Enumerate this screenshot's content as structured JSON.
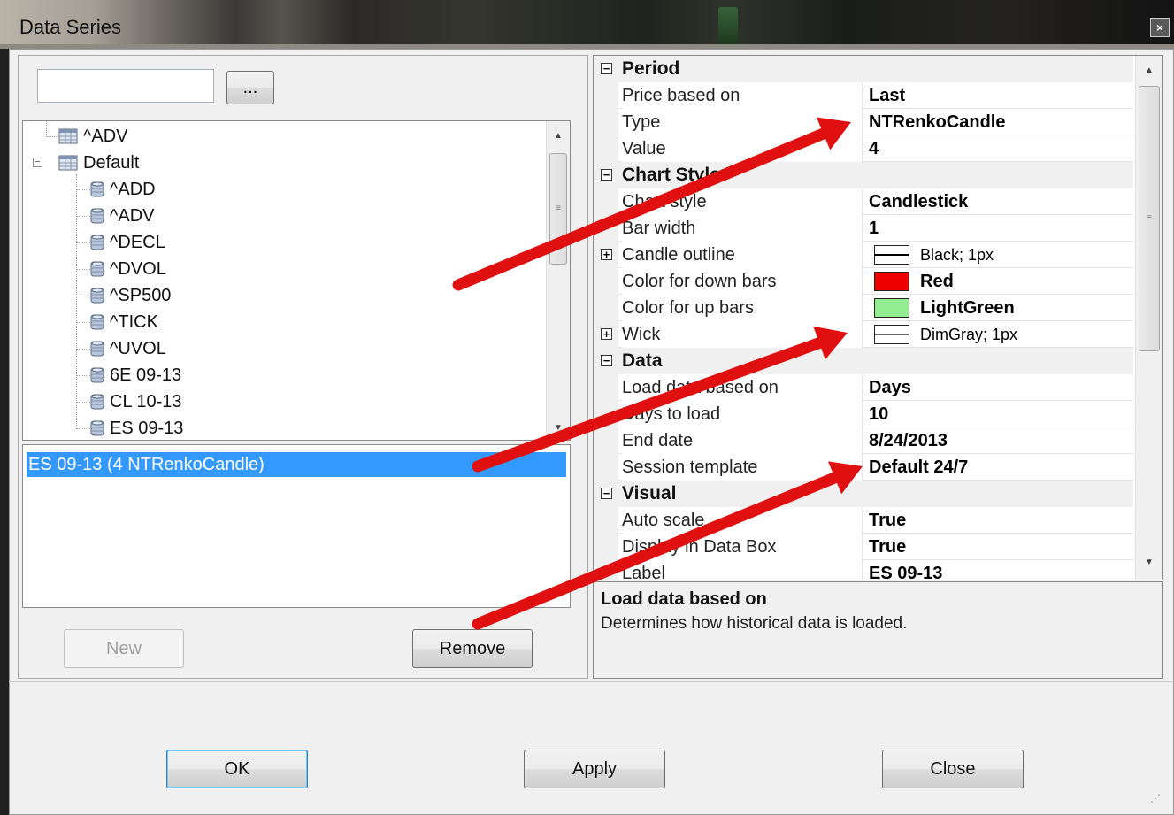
{
  "window": {
    "title": "Data Series",
    "close_glyph": "×"
  },
  "search": {
    "value": "",
    "browse_label": "..."
  },
  "tree": {
    "items": [
      {
        "label": "^ADV",
        "level": 0,
        "kind": "table"
      },
      {
        "label": "Default",
        "level": 0,
        "kind": "table",
        "expanded": true,
        "expander": "−"
      },
      {
        "label": "^ADD",
        "level": 1,
        "kind": "db"
      },
      {
        "label": "^ADV",
        "level": 1,
        "kind": "db"
      },
      {
        "label": "^DECL",
        "level": 1,
        "kind": "db"
      },
      {
        "label": "^DVOL",
        "level": 1,
        "kind": "db"
      },
      {
        "label": "^SP500",
        "level": 1,
        "kind": "db"
      },
      {
        "label": "^TICK",
        "level": 1,
        "kind": "db"
      },
      {
        "label": "^UVOL",
        "level": 1,
        "kind": "db"
      },
      {
        "label": "6E 09-13",
        "level": 1,
        "kind": "db"
      },
      {
        "label": "CL 10-13",
        "level": 1,
        "kind": "db"
      },
      {
        "label": "ES 09-13",
        "level": 1,
        "kind": "db"
      }
    ]
  },
  "series_list": {
    "selected": "ES 09-13 (4 NTRenkoCandle)"
  },
  "buttons": {
    "new": "New",
    "remove": "Remove",
    "ok": "OK",
    "apply": "Apply",
    "close": "Close"
  },
  "properties": {
    "categories": [
      {
        "label": "Period",
        "toggle": "−",
        "rows": [
          {
            "name": "Price based on",
            "value": "Last"
          },
          {
            "name": "Type",
            "value": "NTRenkoCandle"
          },
          {
            "name": "Value",
            "value": "4"
          }
        ]
      },
      {
        "label": "Chart Style",
        "toggle": "−",
        "rows": [
          {
            "name": "Chart style",
            "value": "Candlestick"
          },
          {
            "name": "Bar width",
            "value": "1"
          },
          {
            "name": "Candle outline",
            "value": "Black; 1px",
            "expandable": true,
            "toggle": "+",
            "swatch": "line",
            "swatch_color": "#000000"
          },
          {
            "name": "Color for down bars",
            "value": "Red",
            "swatch": "fill",
            "swatch_color": "#ee0000"
          },
          {
            "name": "Color for up bars",
            "value": "LightGreen",
            "swatch": "fill",
            "swatch_color": "#90ee90"
          },
          {
            "name": "Wick",
            "value": "DimGray; 1px",
            "expandable": true,
            "toggle": "+",
            "swatch": "line",
            "swatch_color": "#696969"
          }
        ]
      },
      {
        "label": "Data",
        "toggle": "−",
        "rows": [
          {
            "name": "Load data based on",
            "value": "Days"
          },
          {
            "name": "Days to load",
            "value": "10"
          },
          {
            "name": "End date",
            "value": "8/24/2013"
          },
          {
            "name": "Session template",
            "value": "Default 24/7"
          }
        ]
      },
      {
        "label": "Visual",
        "toggle": "−",
        "rows": [
          {
            "name": "Auto scale",
            "value": "True"
          },
          {
            "name": "Display in Data Box",
            "value": "True"
          },
          {
            "name": "Label",
            "value": "ES 09-13"
          }
        ]
      }
    ]
  },
  "help": {
    "title": "Load data based on",
    "text": "Determines how historical data is loaded."
  },
  "colors": {
    "selection": "#3399ff",
    "annotation_arrow": "#e01010"
  }
}
